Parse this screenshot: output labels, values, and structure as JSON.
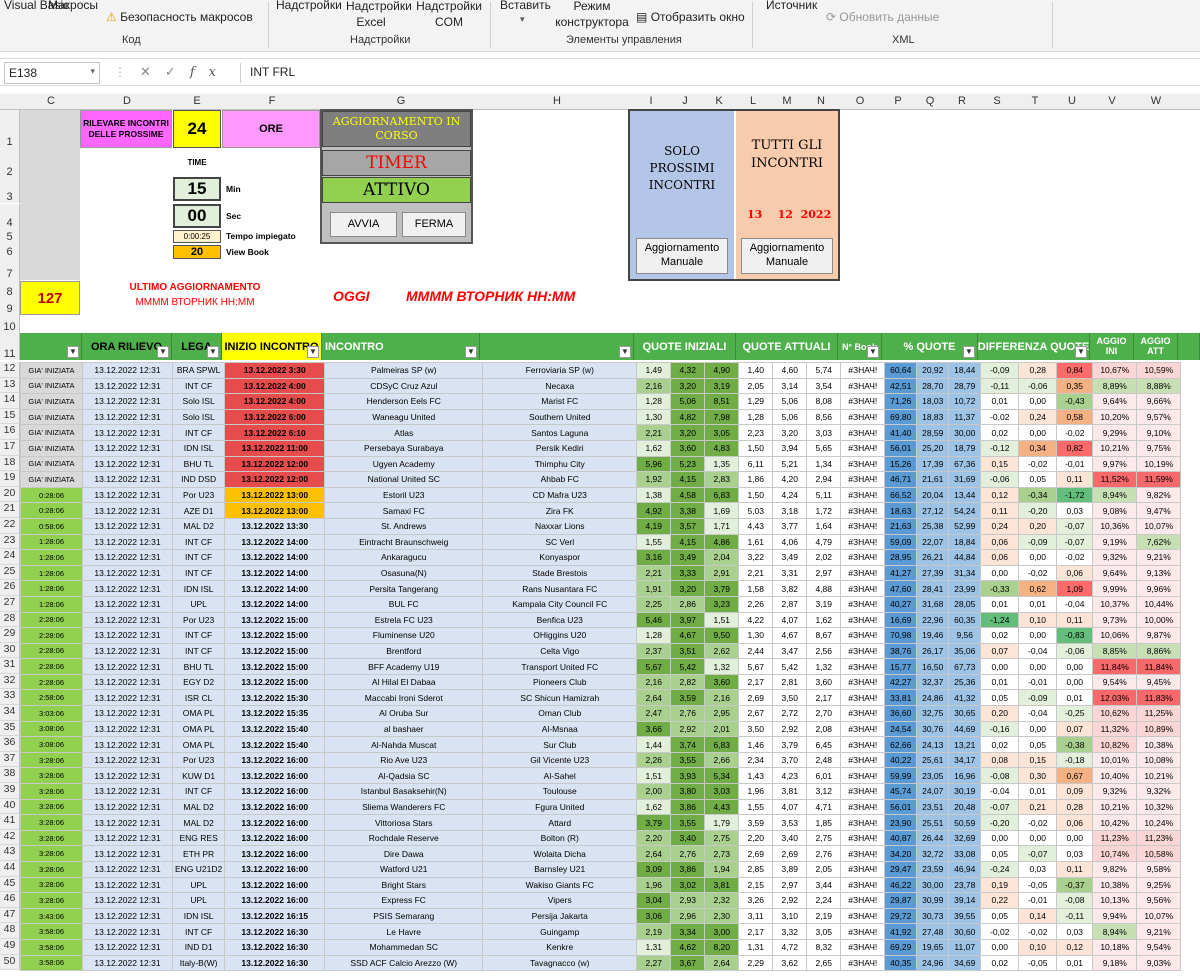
{
  "ribbon": {
    "visual_basic": "Visual Basic",
    "macros": "Макросы",
    "macro_security": "Безопасность макросов",
    "group_code": "Код",
    "addins": "Надстройки",
    "excel_addins": "Надстройки Excel",
    "com_addins": "Надстройки COM",
    "group_addins": "Надстройки",
    "insert": "Вставить",
    "design_mode": "Режим конструктора",
    "view_code": "Отобразить окно",
    "group_controls": "Элементы управления",
    "source": "Источник",
    "refresh_data": "Обновить данные",
    "group_xml": "XML"
  },
  "formula_bar": {
    "name_box": "E138",
    "formula": "INT FRL"
  },
  "columns": [
    "C",
    "D",
    "E",
    "F",
    "G",
    "H",
    "I",
    "J",
    "K",
    "L",
    "M",
    "N",
    "O",
    "P",
    "Q",
    "R",
    "S",
    "T",
    "U",
    "V",
    "W"
  ],
  "top_rows": [
    "1",
    "2",
    "3",
    "4",
    "5",
    "6",
    "7",
    "8",
    "9",
    "10",
    "11"
  ],
  "panel": {
    "rilevare": "RILEVARE INCONTRI DELLE PROSSIME",
    "hours": "24",
    "ore": "ORE",
    "time_label": "TIME",
    "min_value": "15",
    "min_label": "Min",
    "sec_value": "00",
    "sec_label": "Sec",
    "tempo_value": "0:00:25",
    "tempo_label": "Tempo impiegato",
    "view_value": "20",
    "view_label": "View Book",
    "count": "127",
    "ultimo": "ULTIMO AGGIORNAMENTO",
    "ultimo_fmt": "MMMM ВТОРНИК НН:MM",
    "oggi": "OGGI",
    "oggi_fmt": "MMMM ВТОРНИК НН:MM",
    "aggiornamento": "AGGIORNAMENTO IN CORSO",
    "timer": "TIMER",
    "attivo": "ATTIVO",
    "avvia": "AVVIA",
    "ferma": "FERMA",
    "solo": "SOLO PROSSIMI INCONTRI",
    "tutti": "TUTTI GLI INCONTRI",
    "date_d": "13",
    "date_m": "12",
    "date_y": "2022",
    "manual1": "Aggiornamento Manuale",
    "manual2": "Aggiornamento Manuale"
  },
  "headers": {
    "ora": "ORA RILIEVO",
    "lega": "LEGA",
    "inizio": "INIZIO INCONTRO",
    "incontro": "INCONTRO",
    "quote_iniziali": "QUOTE INIZIALI",
    "quote_attuali": "QUOTE ATTUALI",
    "nbook": "N° Book",
    "perc_quote": "% QUOTE",
    "diff": "DIFFERENZA QUOTE",
    "aggio_in": "AGGIO INI",
    "aggio_at": "AGGIO ATT"
  },
  "rows": [
    [
      "12",
      "GIA' INIZIATA",
      "13.12.2022 12:31",
      "BRA SPWL",
      "13.12.2022 3:30",
      "Palmeiras SP (w)",
      "Ferroviaria SP (w)",
      "1,49",
      "4,32",
      "4,90",
      "1,40",
      "4,60",
      "5,74",
      "#ЗНАЧ!",
      "60,64",
      "20,92",
      "18,44",
      "-0,09",
      "0,28",
      "0,84",
      "10,67%",
      "10,59%"
    ],
    [
      "13",
      "GIA' INIZIATA",
      "13.12.2022 12:31",
      "INT CF",
      "13.12.2022 4:00",
      "CDSyC Cruz Azul",
      "Necaxa",
      "2,16",
      "3,20",
      "3,19",
      "2,05",
      "3,14",
      "3,54",
      "#ЗНАЧ!",
      "42,51",
      "28,70",
      "28,79",
      "-0,11",
      "-0,06",
      "0,35",
      "8,89%",
      "8,88%"
    ],
    [
      "14",
      "GIA' INIZIATA",
      "13.12.2022 12:31",
      "Solo ISL",
      "13.12.2022 4:00",
      "Henderson Eels FC",
      "Marist FC",
      "1,28",
      "5,06",
      "8,51",
      "1,29",
      "5,06",
      "8,08",
      "#ЗНАЧ!",
      "71,26",
      "18,03",
      "10,72",
      "0,01",
      "0,00",
      "-0,43",
      "9,64%",
      "9,66%"
    ],
    [
      "15",
      "GIA' INIZIATA",
      "13.12.2022 12:31",
      "Solo ISL",
      "13.12.2022 6:00",
      "Waneagu United",
      "Southern United",
      "1,30",
      "4,82",
      "7,98",
      "1,28",
      "5,06",
      "8,56",
      "#ЗНАЧ!",
      "69,80",
      "18,83",
      "11,37",
      "-0,02",
      "0,24",
      "0,58",
      "10,20%",
      "9,57%"
    ],
    [
      "16",
      "GIA' INIZIATA",
      "13.12.2022 12:31",
      "INT CF",
      "13.12.2022 6:10",
      "Atlas",
      "Santos Laguna",
      "2,21",
      "3,20",
      "3,05",
      "2,23",
      "3,20",
      "3,03",
      "#ЗНАЧ!",
      "41,40",
      "28,59",
      "30,00",
      "0,02",
      "0,00",
      "-0,02",
      "9,29%",
      "9,10%"
    ],
    [
      "17",
      "GIA' INIZIATA",
      "13.12.2022 12:31",
      "IDN ISL",
      "13.12.2022 11:00",
      "Persebaya Surabaya",
      "Persik Kediri",
      "1,62",
      "3,60",
      "4,83",
      "1,50",
      "3,94",
      "5,65",
      "#ЗНАЧ!",
      "56,01",
      "25,20",
      "18,79",
      "-0,12",
      "0,34",
      "0,82",
      "10,21%",
      "9,75%"
    ],
    [
      "18",
      "GIA' INIZIATA",
      "13.12.2022 12:31",
      "BHU TL",
      "13.12.2022 12:00",
      "Ugyen Academy",
      "Thimphu City",
      "5,96",
      "5,23",
      "1,35",
      "6,11",
      "5,21",
      "1,34",
      "#ЗНАЧ!",
      "15,26",
      "17,39",
      "67,36",
      "0,15",
      "-0,02",
      "-0,01",
      "9,97%",
      "10,19%"
    ],
    [
      "19",
      "GIA' INIZIATA",
      "13.12.2022 12:31",
      "IND DSD",
      "13.12.2022 12:00",
      "National United SC",
      "Ahbab FC",
      "1,92",
      "4,15",
      "2,83",
      "1,86",
      "4,20",
      "2,94",
      "#ЗНАЧ!",
      "46,71",
      "21,61",
      "31,69",
      "-0,06",
      "0,05",
      "0,11",
      "11,52%",
      "11,59%"
    ],
    [
      "20",
      "0:28:06",
      "13.12.2022 12:31",
      "Por U23",
      "13.12.2022 13:00",
      "Estoril U23",
      "CD Mafra U23",
      "1,38",
      "4,58",
      "6,83",
      "1,50",
      "4,24",
      "5,11",
      "#ЗНАЧ!",
      "66,52",
      "20,04",
      "13,44",
      "0,12",
      "-0,34",
      "-1,72",
      "8,94%",
      "9,82%"
    ],
    [
      "21",
      "0:28:06",
      "13.12.2022 12:31",
      "AZE D1",
      "13.12.2022 13:00",
      "Samaxi FC",
      "Zira FK",
      "4,92",
      "3,38",
      "1,69",
      "5,03",
      "3,18",
      "1,72",
      "#ЗНАЧ!",
      "18,63",
      "27,12",
      "54,24",
      "0,11",
      "-0,20",
      "0,03",
      "9,08%",
      "9,47%"
    ],
    [
      "22",
      "0:58:06",
      "13.12.2022 12:31",
      "MAL D2",
      "13.12.2022 13:30",
      "St. Andrews",
      "Naxxar Lions",
      "4,19",
      "3,57",
      "1,71",
      "4,43",
      "3,77",
      "1,64",
      "#ЗНАЧ!",
      "21,63",
      "25,38",
      "52,99",
      "0,24",
      "0,20",
      "-0,07",
      "10,36%",
      "10,07%"
    ],
    [
      "23",
      "1:28:06",
      "13.12.2022 12:31",
      "INT CF",
      "13.12.2022 14:00",
      "Eintracht Braunschweig",
      "SC Verl",
      "1,55",
      "4,15",
      "4,86",
      "1,61",
      "4,06",
      "4,79",
      "#ЗНАЧ!",
      "59,09",
      "22,07",
      "18,84",
      "0,06",
      "-0,09",
      "-0,07",
      "9,19%",
      "7,62%"
    ],
    [
      "24",
      "1:28:06",
      "13.12.2022 12:31",
      "INT CF",
      "13.12.2022 14:00",
      "Ankaragucu",
      "Konyaspor",
      "3,16",
      "3,49",
      "2,04",
      "3,22",
      "3,49",
      "2,02",
      "#ЗНАЧ!",
      "28,95",
      "26,21",
      "44,84",
      "0,06",
      "0,00",
      "-0,02",
      "9,32%",
      "9,21%"
    ],
    [
      "25",
      "1:28:06",
      "13.12.2022 12:31",
      "INT CF",
      "13.12.2022 14:00",
      "Osasuna(N)",
      "Stade Brestois",
      "2,21",
      "3,33",
      "2,91",
      "2,21",
      "3,31",
      "2,97",
      "#ЗНАЧ!",
      "41,27",
      "27,39",
      "31,34",
      "0,00",
      "-0,02",
      "0,06",
      "9,64%",
      "9,13%"
    ],
    [
      "26",
      "1:28:06",
      "13.12.2022 12:31",
      "IDN ISL",
      "13.12.2022 14:00",
      "Persita Tangerang",
      "Rans Nusantara FC",
      "1,91",
      "3,20",
      "3,79",
      "1,58",
      "3,82",
      "4,88",
      "#ЗНАЧ!",
      "47,60",
      "28,41",
      "23,99",
      "-0,33",
      "0,62",
      "1,09",
      "9,99%",
      "9,96%"
    ],
    [
      "27",
      "1:28:06",
      "13.12.2022 12:31",
      "UPL",
      "13.12.2022 14:00",
      "BUL FC",
      "Kampala City Council FC",
      "2,25",
      "2,86",
      "3,23",
      "2,26",
      "2,87",
      "3,19",
      "#ЗНАЧ!",
      "40,27",
      "31,68",
      "28,05",
      "0,01",
      "0,01",
      "-0,04",
      "10,37%",
      "10,44%"
    ],
    [
      "28",
      "2:28:06",
      "13.12.2022 12:31",
      "Por U23",
      "13.12.2022 15:00",
      "Estrela FC U23",
      "Benfica U23",
      "5,46",
      "3,97",
      "1,51",
      "4,22",
      "4,07",
      "1,62",
      "#ЗНАЧ!",
      "16,69",
      "22,96",
      "60,35",
      "-1,24",
      "0,10",
      "0,11",
      "9,73%",
      "10,00%"
    ],
    [
      "29",
      "2:28:06",
      "13.12.2022 12:31",
      "INT CF",
      "13.12.2022 15:00",
      "Fluminense U20",
      "OHiggins U20",
      "1,28",
      "4,67",
      "9,50",
      "1,30",
      "4,67",
      "8,67",
      "#ЗНАЧ!",
      "70,98",
      "19,46",
      "9,56",
      "0,02",
      "0,00",
      "-0,83",
      "10,06%",
      "9,87%"
    ],
    [
      "30",
      "2:28:06",
      "13.12.2022 12:31",
      "INT CF",
      "13.12.2022 15:00",
      "Brentford",
      "Celta Vigo",
      "2,37",
      "3,51",
      "2,62",
      "2,44",
      "3,47",
      "2,56",
      "#ЗНАЧ!",
      "38,76",
      "26,17",
      "35,06",
      "0,07",
      "-0,04",
      "-0,06",
      "8,85%",
      "8,86%"
    ],
    [
      "31",
      "2:28:06",
      "13.12.2022 12:31",
      "BHU TL",
      "13.12.2022 15:00",
      "BFF Academy U19",
      "Transport United FC",
      "5,67",
      "5,42",
      "1,32",
      "5,67",
      "5,42",
      "1,32",
      "#ЗНАЧ!",
      "15,77",
      "16,50",
      "67,73",
      "0,00",
      "0,00",
      "0,00",
      "11,84%",
      "11,84%"
    ],
    [
      "32",
      "2:28:06",
      "13.12.2022 12:31",
      "EGY D2",
      "13.12.2022 15:00",
      "Al Hilal El Dabaa",
      "Pioneers Club",
      "2,16",
      "2,82",
      "3,60",
      "2,17",
      "2,81",
      "3,60",
      "#ЗНАЧ!",
      "42,27",
      "32,37",
      "25,36",
      "0,01",
      "-0,01",
      "0,00",
      "9,54%",
      "9,45%"
    ],
    [
      "33",
      "2:58:06",
      "13.12.2022 12:31",
      "ISR CL",
      "13.12.2022 15:30",
      "Maccabi Ironi Sderot",
      "SC Shicun Hamizrah",
      "2,64",
      "3,59",
      "2,16",
      "2,69",
      "3,50",
      "2,17",
      "#ЗНАЧ!",
      "33,81",
      "24,86",
      "41,32",
      "0,05",
      "-0,09",
      "0,01",
      "12,03%",
      "11,83%"
    ],
    [
      "34",
      "3:03:06",
      "13.12.2022 12:31",
      "OMA PL",
      "13.12.2022 15:35",
      "Al Oruba Sur",
      "Oman Club",
      "2,47",
      "2,76",
      "2,95",
      "2,67",
      "2,72",
      "2,70",
      "#ЗНАЧ!",
      "36,60",
      "32,75",
      "30,65",
      "0,20",
      "-0,04",
      "-0,25",
      "10,62%",
      "11,25%"
    ],
    [
      "35",
      "3:08:06",
      "13.12.2022 12:31",
      "OMA PL",
      "13.12.2022 15:40",
      "al bashaer",
      "Al-Msnaa",
      "3,66",
      "2,92",
      "2,01",
      "3,50",
      "2,92",
      "2,08",
      "#ЗНАЧ!",
      "24,54",
      "30,76",
      "44,69",
      "-0,16",
      "0,00",
      "0,07",
      "11,32%",
      "10,89%"
    ],
    [
      "36",
      "3:08:06",
      "13.12.2022 12:31",
      "OMA PL",
      "13.12.2022 15:40",
      "Al-Nahda Muscat",
      "Sur Club",
      "1,44",
      "3,74",
      "6,83",
      "1,46",
      "3,79",
      "6,45",
      "#ЗНАЧ!",
      "62,66",
      "24,13",
      "13,21",
      "0,02",
      "0,05",
      "-0,38",
      "10,82%",
      "10,38%"
    ],
    [
      "37",
      "3:28:06",
      "13.12.2022 12:31",
      "Por U23",
      "13.12.2022 16:00",
      "Rio Ave U23",
      "Gil Vicente U23",
      "2,26",
      "3,55",
      "2,66",
      "2,34",
      "3,70",
      "2,48",
      "#ЗНАЧ!",
      "40,22",
      "25,61",
      "34,17",
      "0,08",
      "0,15",
      "-0,18",
      "10,01%",
      "10,08%"
    ],
    [
      "38",
      "3:28:06",
      "13.12.2022 12:31",
      "KUW D1",
      "13.12.2022 16:00",
      "Al-Qadsia SC",
      "Al-Sahel",
      "1,51",
      "3,93",
      "5,34",
      "1,43",
      "4,23",
      "6,01",
      "#ЗНАЧ!",
      "59,99",
      "23,05",
      "16,96",
      "-0,08",
      "0,30",
      "0,67",
      "10,40%",
      "10,21%"
    ],
    [
      "39",
      "3:28:06",
      "13.12.2022 12:31",
      "INT CF",
      "13.12.2022 16:00",
      "Istanbul Basaksehir(N)",
      "Toulouse",
      "2,00",
      "3,80",
      "3,03",
      "1,96",
      "3,81",
      "3,12",
      "#ЗНАЧ!",
      "45,74",
      "24,07",
      "30,19",
      "-0,04",
      "0,01",
      "0,09",
      "9,32%",
      "9,32%"
    ],
    [
      "40",
      "3:28:06",
      "13.12.2022 12:31",
      "MAL D2",
      "13.12.2022 16:00",
      "Sliema Wanderers FC",
      "Fgura United",
      "1,62",
      "3,86",
      "4,43",
      "1,55",
      "4,07",
      "4,71",
      "#ЗНАЧ!",
      "56,01",
      "23,51",
      "20,48",
      "-0,07",
      "0,21",
      "0,28",
      "10,21%",
      "10,32%"
    ],
    [
      "41",
      "3:28:06",
      "13.12.2022 12:31",
      "MAL D2",
      "13.12.2022 16:00",
      "Vittoriosa Stars",
      "Attard",
      "3,79",
      "3,55",
      "1,79",
      "3,59",
      "3,53",
      "1,85",
      "#ЗНАЧ!",
      "23,90",
      "25,51",
      "50,59",
      "-0,20",
      "-0,02",
      "0,06",
      "10,42%",
      "10,24%"
    ],
    [
      "42",
      "3:28:06",
      "13.12.2022 12:31",
      "ENG RES",
      "13.12.2022 16:00",
      "Rochdale Reserve",
      "Bolton (R)",
      "2,20",
      "3,40",
      "2,75",
      "2,20",
      "3,40",
      "2,75",
      "#ЗНАЧ!",
      "40,87",
      "26,44",
      "32,69",
      "0,00",
      "0,00",
      "0,00",
      "11,23%",
      "11,23%"
    ],
    [
      "43",
      "3:28:06",
      "13.12.2022 12:31",
      "ETH PR",
      "13.12.2022 16:00",
      "Dire Dawa",
      "Wolaita Dicha",
      "2,64",
      "2,76",
      "2,73",
      "2,69",
      "2,69",
      "2,76",
      "#ЗНАЧ!",
      "34,20",
      "32,72",
      "33,08",
      "0,05",
      "-0,07",
      "0,03",
      "10,74%",
      "10,58%"
    ],
    [
      "44",
      "3:28:06",
      "13.12.2022 12:31",
      "ENG U21D2",
      "13.12.2022 16:00",
      "Watford U21",
      "Barnsley U21",
      "3,09",
      "3,86",
      "1,94",
      "2,85",
      "3,89",
      "2,05",
      "#ЗНАЧ!",
      "29,47",
      "23,59",
      "46,94",
      "-0,24",
      "0,03",
      "0,11",
      "9,82%",
      "9,58%"
    ],
    [
      "45",
      "3:28:06",
      "13.12.2022 12:31",
      "UPL",
      "13.12.2022 16:00",
      "Bright Stars",
      "Wakiso Giants FC",
      "1,96",
      "3,02",
      "3,81",
      "2,15",
      "2,97",
      "3,44",
      "#ЗНАЧ!",
      "46,22",
      "30,00",
      "23,78",
      "0,19",
      "-0,05",
      "-0,37",
      "10,38%",
      "9,25%"
    ],
    [
      "46",
      "3:28:06",
      "13.12.2022 12:31",
      "UPL",
      "13.12.2022 16:00",
      "Express FC",
      "Vipers",
      "3,04",
      "2,93",
      "2,32",
      "3,26",
      "2,92",
      "2,24",
      "#ЗНАЧ!",
      "29,87",
      "30,99",
      "39,14",
      "0,22",
      "-0,01",
      "-0,08",
      "10,13%",
      "9,56%"
    ],
    [
      "47",
      "3:43:06",
      "13.12.2022 12:31",
      "IDN ISL",
      "13.12.2022 16:15",
      "PSIS Semarang",
      "Persija Jakarta",
      "3,06",
      "2,96",
      "2,30",
      "3,11",
      "3,10",
      "2,19",
      "#ЗНАЧ!",
      "29,72",
      "30,73",
      "39,55",
      "0,05",
      "0,14",
      "-0,11",
      "9,94%",
      "10,07%"
    ],
    [
      "48",
      "3:58:06",
      "13.12.2022 12:31",
      "INT CF",
      "13.12.2022 16:30",
      "Le Havre",
      "Guingamp",
      "2,19",
      "3,34",
      "3,00",
      "2,17",
      "3,32",
      "3,05",
      "#ЗНАЧ!",
      "41,92",
      "27,48",
      "30,60",
      "-0,02",
      "-0,02",
      "0,03",
      "8,94%",
      "9,21%"
    ],
    [
      "49",
      "3:58:06",
      "13.12.2022 12:31",
      "IND D1",
      "13.12.2022 16:30",
      "Mohammedan SC",
      "Kenkre",
      "1,31",
      "4,62",
      "8,20",
      "1,31",
      "4,72",
      "8,32",
      "#ЗНАЧ!",
      "69,29",
      "19,65",
      "11,07",
      "0,00",
      "0,10",
      "0,12",
      "10,18%",
      "9,54%"
    ],
    [
      "50",
      "3:58:06",
      "13.12.2022 12:31",
      "Italy-B(W)",
      "13.12.2022 16:30",
      "SSD ACF Calcio Arezzo (W)",
      "Tavagnacco (w)",
      "2,27",
      "3,67",
      "2,64",
      "2,29",
      "3,62",
      "2,65",
      "#ЗНАЧ!",
      "40,35",
      "24,96",
      "34,69",
      "0,02",
      "-0,05",
      "0,01",
      "9,18%",
      "9,03%"
    ]
  ]
}
